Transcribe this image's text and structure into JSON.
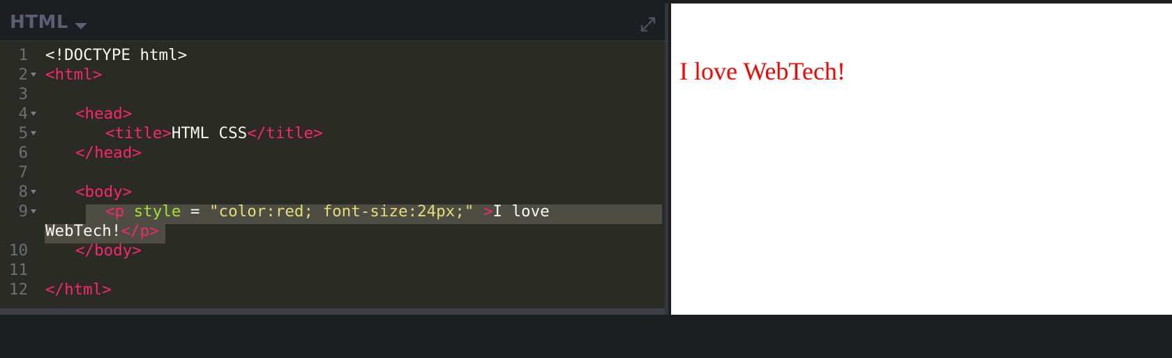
{
  "editor": {
    "language": "HTML",
    "lines": [
      {
        "num": "1",
        "parts": [
          "<!DOCTYPE html>"
        ]
      },
      {
        "num": "2",
        "parts": [
          "<html>"
        ]
      },
      {
        "num": "3",
        "parts": []
      },
      {
        "num": "4",
        "parts": [
          "<head>"
        ]
      },
      {
        "num": "5",
        "parts": [
          "<title>",
          "HTML CSS",
          "</title>"
        ]
      },
      {
        "num": "6",
        "parts": [
          "</head>"
        ]
      },
      {
        "num": "7",
        "parts": []
      },
      {
        "num": "8",
        "parts": [
          "<body>"
        ]
      },
      {
        "num": "9",
        "parts": [
          "<p",
          " style",
          " = ",
          "\"color:red; font-size:24px;\"",
          " >",
          "I love"
        ]
      },
      {
        "num": "",
        "parts": [
          "WebTech!",
          "</p>"
        ]
      },
      {
        "num": "10",
        "parts": [
          "</body>"
        ]
      },
      {
        "num": "11",
        "parts": []
      },
      {
        "num": "12",
        "parts": [
          "</html>"
        ]
      }
    ]
  },
  "preview": {
    "text": "I love WebTech!",
    "color": "#ff0000",
    "font_size": "24px"
  },
  "colors": {
    "tag": "#f92672",
    "attribute": "#a6e22e",
    "string": "#e6db74",
    "text": "#f8f8f2",
    "editor_bg": "#2b2b26",
    "header_bg": "#1d1e22"
  },
  "icons": {
    "dropdown": "caret-down-icon",
    "expand": "expand-icon",
    "fold": "fold-arrow-icon"
  }
}
